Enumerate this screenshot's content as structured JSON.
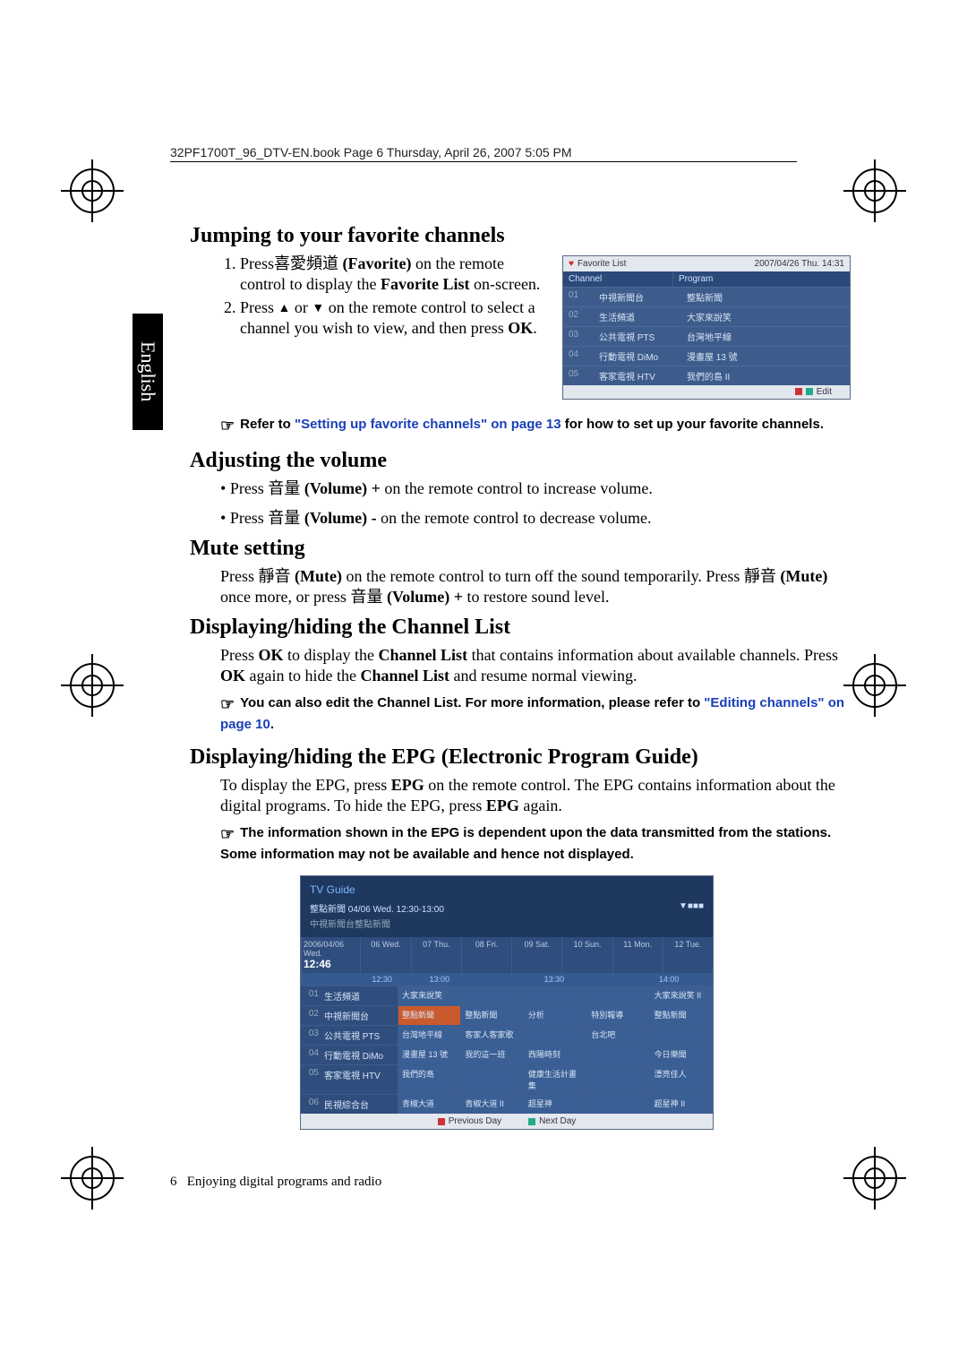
{
  "header": "32PF1700T_96_DTV-EN.book  Page 6  Thursday, April 26, 2007  5:05 PM",
  "lang_tab": "English",
  "footer_page": "6",
  "footer_text": "Enjoying digital programs and radio",
  "h1": "Jumping to your favorite channels",
  "step1_a": "Press",
  "step1_cjk": "喜愛頻道",
  "step1_b": " (Favorite) ",
  "step1_c": "on the remote control to display the ",
  "step1_bold": "Favorite List",
  "step1_d": " on-screen.",
  "step2_a": "Press ",
  "step2_b": " or ",
  "step2_c": " on the remote control to select a channel you wish to view, and then press ",
  "step2_ok": "OK",
  "step2_d": ".",
  "note1_a": "Refer to ",
  "note1_link": "\"Setting up favorite channels\" on page 13",
  "note1_b": " for how to set up your favorite channels.",
  "h2": "Adjusting the volume",
  "vol1_a": "Press ",
  "vol1_cjk": "音量",
  "vol1_b": " (Volume) +",
  "vol1_c": " on the remote control to increase volume.",
  "vol2_a": "Press ",
  "vol2_cjk": "音量",
  "vol2_b": " (Volume) -",
  "vol2_c": " on the remote control to decrease volume.",
  "h3": "Mute setting",
  "mute_a": "Press ",
  "mute_cjk": "靜音",
  "mute_b": " (Mute)",
  "mute_c": " on the remote control to turn off the sound temporarily. Press ",
  "mute_cjk2": "靜音",
  "mute_d": " (Mute)",
  "mute_e": " once more, or press ",
  "mute_cjk3": "音量",
  "mute_f": " (Volume) +",
  "mute_g": " to restore sound level.",
  "h4": "Displaying/hiding the Channel List",
  "cl_a": "Press ",
  "cl_ok1": "OK",
  "cl_b": " to display the ",
  "cl_bold": "Channel List",
  "cl_c": " that contains information about available channels. Press ",
  "cl_ok2": "OK",
  "cl_d": " again to hide the ",
  "cl_bold2": "Channel List",
  "cl_e": " and resume normal viewing.",
  "note2_a": "You can also edit the Channel List. For more information, please refer to ",
  "note2_link": "\"Editing channels\" on page 10",
  "note2_b": ".",
  "h5": "Displaying/hiding the EPG (Electronic Program Guide)",
  "epg_a": "To display the EPG, press ",
  "epg_b1": "EPG",
  "epg_c": " on the remote control. The EPG contains information about the digital programs. To hide the EPG, press ",
  "epg_b2": "EPG",
  "epg_d": " again.",
  "note3": "The information shown in the EPG is dependent upon the data transmitted from the stations. Some information may not be available and hence not displayed.",
  "fav": {
    "title": "Favorite List",
    "date": "2007/04/26  Thu.  14:31",
    "col1": "Channel",
    "col2": "Program",
    "rows": [
      {
        "n": "01",
        "ch": "中視新聞台",
        "pg": "整點新聞"
      },
      {
        "n": "02",
        "ch": "生活頻道",
        "pg": "大家來說笑"
      },
      {
        "n": "03",
        "ch": "公共電視 PTS",
        "pg": "台灣地平線"
      },
      {
        "n": "04",
        "ch": "行動電視 DiMo",
        "pg": "漫畫屋 13 號"
      },
      {
        "n": "05",
        "ch": "客家電視 HTV",
        "pg": "我們的島 II"
      }
    ],
    "edit": "Edit"
  },
  "epgshot": {
    "title": "TV Guide",
    "info": "整點新聞  04/06 Wed. 12:30-13:00",
    "sub": "中視新聞台整點新聞",
    "brand": "▼■■■",
    "date": "2006/04/06 Wed.",
    "clock": "12:46",
    "days": [
      "06 Wed.",
      "07 Thu.",
      "08 Fri.",
      "09 Sat.",
      "10 Sun.",
      "11 Mon.",
      "12 Tue."
    ],
    "times": [
      "12:30",
      "13:00",
      "",
      "13:30",
      "",
      "14:00"
    ],
    "rows": [
      {
        "n": "01",
        "ch": "生活頻道",
        "c": [
          "大家來說笑",
          "",
          "",
          "",
          "大家來說笑 II"
        ]
      },
      {
        "n": "02",
        "ch": "中視新聞台",
        "c": [
          "整點新聞",
          "整點新聞",
          "分析",
          "特別報導",
          "整點新聞"
        ]
      },
      {
        "n": "03",
        "ch": "公共電視 PTS",
        "c": [
          "台灣地平線",
          "客家人客家歌",
          "",
          "台北吧",
          ""
        ]
      },
      {
        "n": "04",
        "ch": "行動電視 DiMo",
        "c": [
          "漫畫屋 13 號",
          "我的這一班",
          "西陽時刻",
          "",
          "今日樂聞"
        ]
      },
      {
        "n": "05",
        "ch": "客家電視 HTV",
        "c": [
          "我們的島",
          "",
          "健康生活計畫集",
          "",
          "漂亮佳人"
        ]
      },
      {
        "n": "06",
        "ch": "民視綜合台",
        "c": [
          "青椒大道",
          "青椒大道 II",
          "超星神",
          "",
          "超星神 II"
        ]
      }
    ],
    "prev": "Previous Day",
    "next": "Next Day"
  }
}
